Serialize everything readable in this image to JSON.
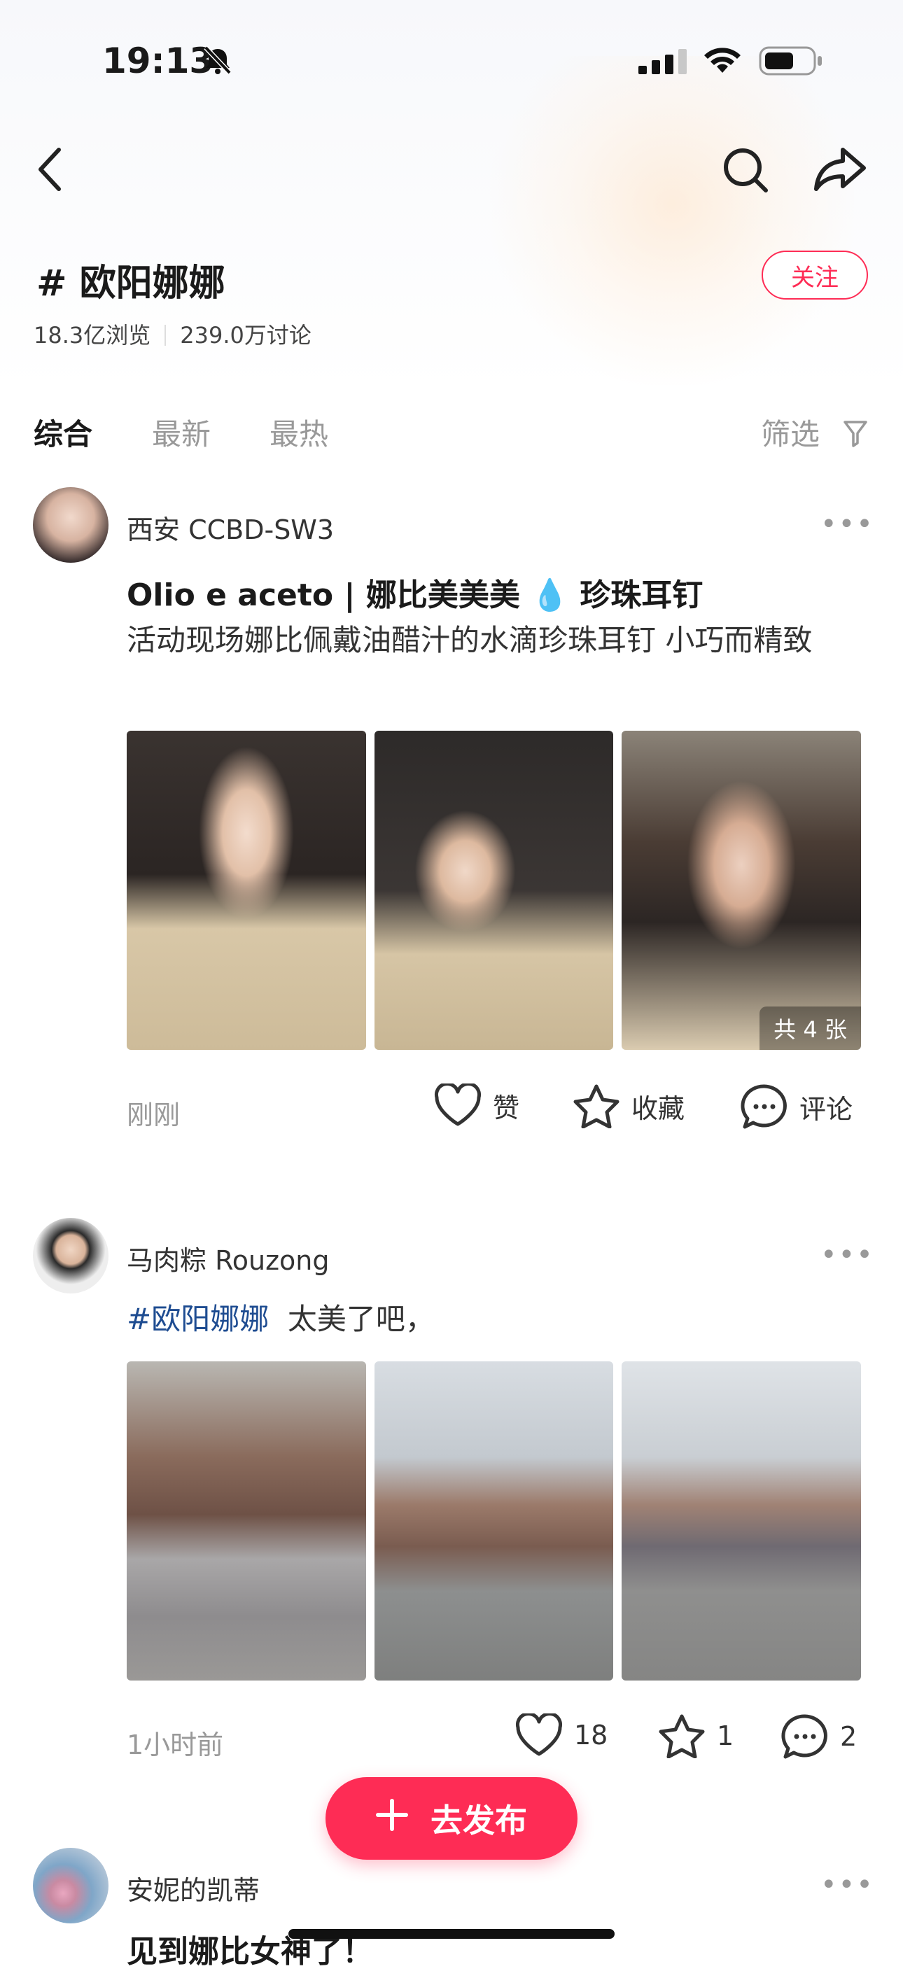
{
  "status_bar": {
    "time": "19:13"
  },
  "topic": {
    "title": "# 欧阳娜娜",
    "views": "18.3亿浏览",
    "discussions": "239.0万讨论",
    "follow_label": "关注"
  },
  "tabs": [
    {
      "label": "综合",
      "active": true
    },
    {
      "label": "最新",
      "active": false
    },
    {
      "label": "最热",
      "active": false
    }
  ],
  "filter_label": "筛选",
  "posts": [
    {
      "username": "西安 CCBD-SW3",
      "title": "Olio e aceto | 娜比美美美 💧 珍珠耳钉",
      "body": "活动现场娜比佩戴油醋汁的水滴珍珠耳钉 小巧而精致",
      "image_count_label": "共 4 张",
      "time": "刚刚",
      "like_label": "赞",
      "collect_label": "收藏",
      "comment_label": "评论"
    },
    {
      "username": "马肉粽 Rouzong",
      "hashtag": "#欧阳娜娜",
      "body": "太美了吧，",
      "time": "1小时前",
      "likes": "18",
      "collects": "1",
      "comments": "2"
    },
    {
      "username": "安妮的凯蒂",
      "body": "见到娜比女神了！"
    }
  ],
  "publish_label": "去发布",
  "colors": {
    "accent": "#fe2c55",
    "hashtag": "#1e4c91"
  }
}
